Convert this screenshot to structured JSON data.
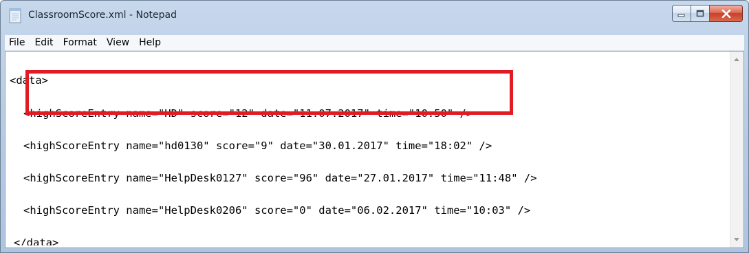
{
  "window": {
    "title": "ClassroomScore.xml - Notepad",
    "accent_color": "#c7d8ec",
    "close_color": "#c8402b"
  },
  "menu": [
    "File",
    "Edit",
    "Format",
    "View",
    "Help"
  ],
  "document": {
    "lines": [
      "<data>",
      "<highScoreEntry name=\"HD\" score=\"12\" date=\"11.07.2017\" time=\"10:50\" />",
      "<highScoreEntry name=\"hd0130\" score=\"9\" date=\"30.01.2017\" time=\"18:02\" />",
      "<highScoreEntry name=\"HelpDesk0127\" score=\"96\" date=\"27.01.2017\" time=\"11:48\" />",
      "<highScoreEntry name=\"HelpDesk0206\" score=\"0\" date=\"06.02.2017\" time=\"10:03\" />",
      "</data>"
    ],
    "highlight_color": "#e01b24"
  }
}
